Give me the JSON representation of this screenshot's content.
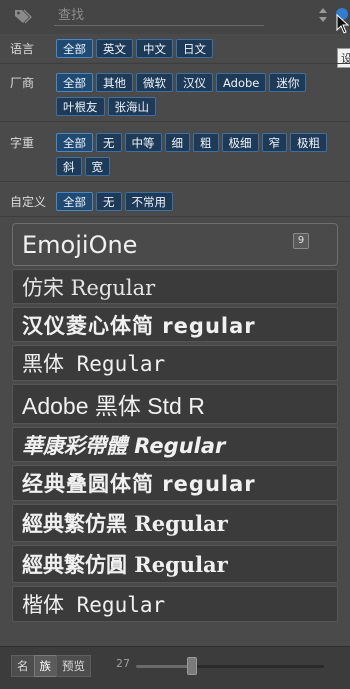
{
  "search": {
    "placeholder": "查找"
  },
  "tooltip": {
    "text": "设"
  },
  "filters": [
    {
      "label": "语言",
      "chips": [
        "全部",
        "英文",
        "中文",
        "日文"
      ]
    },
    {
      "label": "厂商",
      "chips": [
        "全部",
        "其他",
        "微软",
        "汉仪",
        "Adobe",
        "迷你",
        "叶根友",
        "张海山"
      ]
    },
    {
      "label": "字重",
      "chips": [
        "全部",
        "无",
        "中等",
        "细",
        "粗",
        "极细",
        "窄",
        "极粗",
        "斜",
        "宽"
      ]
    },
    {
      "label": "自定义",
      "chips": [
        "全部",
        "无",
        "不常用"
      ]
    }
  ],
  "fonts": [
    {
      "name": "EmojiOne",
      "badge": "9"
    },
    {
      "name": "仿宋 Regular"
    },
    {
      "name": "汉仪菱心体简 regular"
    },
    {
      "name": "黑体 Regular"
    },
    {
      "name": "Adobe 黑体 Std R"
    },
    {
      "name": "華康彩帶體 Regular"
    },
    {
      "name": "经典叠圆体简 regular"
    },
    {
      "name": "經典繁仿黑 Regular"
    },
    {
      "name": "經典繁仿圓 Regular"
    },
    {
      "name": "楷体 Regular"
    }
  ],
  "bottom": {
    "modes": [
      "名",
      "族",
      "预览"
    ],
    "active_mode": "族",
    "size_value": "27",
    "size_fraction": 0.3
  },
  "icons": {
    "tag": "tag-icon",
    "sort": "sort-icon",
    "pin": "pin-icon",
    "cursor": "cursor-icon"
  }
}
